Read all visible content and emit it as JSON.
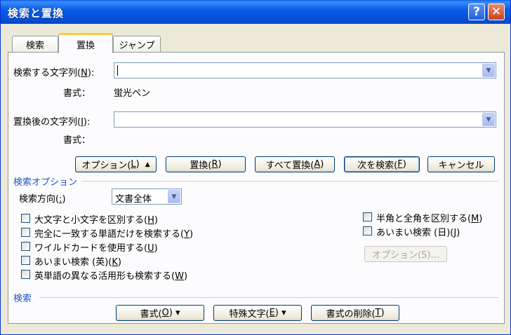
{
  "window": {
    "title": "検索と置換",
    "help_icon": "?",
    "close_icon": "✕"
  },
  "tabs": [
    {
      "label": "検索",
      "active": false
    },
    {
      "label": "置換",
      "active": true
    },
    {
      "label": "ジャンプ",
      "active": false
    }
  ],
  "find": {
    "label_main": "検索する文字列(",
    "label_key": "N",
    "label_end": "):",
    "value": "",
    "format_label": "書式：",
    "format_value": "蛍光ペン"
  },
  "replace": {
    "label_main": "置換後の文字列(",
    "label_key": "I",
    "label_end": "):",
    "value": "",
    "format_label": "書式："
  },
  "buttons": {
    "options_main": "オプション(",
    "options_key": "L",
    "options_end": ")",
    "options_arrow": "▲",
    "replace_main": "置換(",
    "replace_key": "R",
    "replace_end": ")",
    "replace_all_main": "すべて置換(",
    "replace_all_key": "A",
    "replace_all_end": ")",
    "find_next_main": "次を検索(",
    "find_next_key": "F",
    "find_next_end": ")",
    "cancel": "キャンセル"
  },
  "search_options": {
    "section_title": "検索オプション",
    "direction_label": "検索方向(",
    "direction_key": ":",
    "direction_end": ")",
    "direction_value": "文書全体",
    "left_checks": [
      {
        "main": "大文字と小文字を区別する(",
        "key": "H",
        "end": ")",
        "checked": false
      },
      {
        "main": "完全に一致する単語だけを検索する(",
        "key": "Y",
        "end": ")",
        "checked": false
      },
      {
        "main": "ワイルドカードを使用する(",
        "key": "U",
        "end": ")",
        "checked": false
      },
      {
        "main": "あいまい検索 (英)(",
        "key": "K",
        "end": ")",
        "checked": false
      },
      {
        "main": "英単語の異なる活用形も検索する(",
        "key": "W",
        "end": ")",
        "checked": false
      }
    ],
    "right_checks": [
      {
        "main": "半角と全角を区別する(",
        "key": "M",
        "end": ")",
        "checked": false
      },
      {
        "main": "あいまい検索 (日)(",
        "key": "J",
        "end": ")",
        "checked": false
      }
    ],
    "options_button": "オプション(S)..."
  },
  "search_section": {
    "title": "検索",
    "format_main": "書式(",
    "format_key": "O",
    "format_end": ") ▾",
    "special_main": "特殊文字(",
    "special_key": "E",
    "special_end": ") ▾",
    "clear_main": "書式の削除(",
    "clear_key": "T",
    "clear_end": ")"
  }
}
